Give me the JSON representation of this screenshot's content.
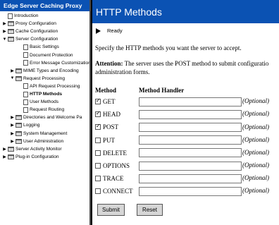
{
  "sidebar": {
    "title": "Edge Server Caching Proxy",
    "items": [
      {
        "label": "Introduction",
        "icon": "document-icon",
        "toggle": ""
      },
      {
        "label": "Proxy Configuration",
        "icon": "folder-icon",
        "toggle": "▶"
      },
      {
        "label": "Cache Configuration",
        "icon": "folder-icon",
        "toggle": "▶"
      },
      {
        "label": "Server Configuration",
        "icon": "folder-icon",
        "toggle": "▼"
      },
      {
        "label": "Basic Settings",
        "icon": "document-icon",
        "toggle": ""
      },
      {
        "label": "Document Protection",
        "icon": "document-icon",
        "toggle": ""
      },
      {
        "label": "Error Message Customization",
        "icon": "document-icon",
        "toggle": ""
      },
      {
        "label": "MIME Types and Encoding",
        "icon": "folder-icon",
        "toggle": "▶"
      },
      {
        "label": "Request Processing",
        "icon": "folder-icon",
        "toggle": "▼"
      },
      {
        "label": "API Request Processing",
        "icon": "document-icon",
        "toggle": ""
      },
      {
        "label": "HTTP Methods",
        "icon": "document-icon",
        "toggle": ""
      },
      {
        "label": "User Methods",
        "icon": "document-icon",
        "toggle": ""
      },
      {
        "label": "Request Routing",
        "icon": "document-icon",
        "toggle": ""
      },
      {
        "label": "Directories and Welcome Pa",
        "icon": "folder-icon",
        "toggle": "▶"
      },
      {
        "label": "Logging",
        "icon": "folder-icon",
        "toggle": "▶"
      },
      {
        "label": "System Management",
        "icon": "folder-icon",
        "toggle": "▶"
      },
      {
        "label": "User Administration",
        "icon": "folder-icon",
        "toggle": "▶"
      },
      {
        "label": "Server Activity Monitor",
        "icon": "folder-icon",
        "toggle": "▶"
      },
      {
        "label": "Plug-in Configuration",
        "icon": "folder-icon",
        "toggle": "▶"
      }
    ]
  },
  "main": {
    "title": "HTTP Methods",
    "status": "Ready",
    "intro": "Specify the HTTP methods you want the server to accept.",
    "attention_label": "Attention:",
    "attention_line1": " The server uses the POST method to submit configuratio",
    "attention_line2": "administration forms.",
    "col_method": "Method",
    "col_handler": "Method Handler",
    "methods": [
      {
        "name": "GET",
        "checked": true,
        "optional": "(Optional)"
      },
      {
        "name": "HEAD",
        "checked": true,
        "optional": "(Optional)"
      },
      {
        "name": "POST",
        "checked": true,
        "optional": "(Optional)"
      },
      {
        "name": "PUT",
        "checked": false,
        "optional": "(Optional)"
      },
      {
        "name": "DELETE",
        "checked": false,
        "optional": "(Optional)"
      },
      {
        "name": "OPTIONS",
        "checked": false,
        "optional": "(Optional)"
      },
      {
        "name": "TRACE",
        "checked": false,
        "optional": "(Optional)"
      },
      {
        "name": "CONNECT",
        "checked": false,
        "optional": "(Optional)"
      }
    ],
    "submit_label": "Submit",
    "reset_label": "Reset"
  }
}
